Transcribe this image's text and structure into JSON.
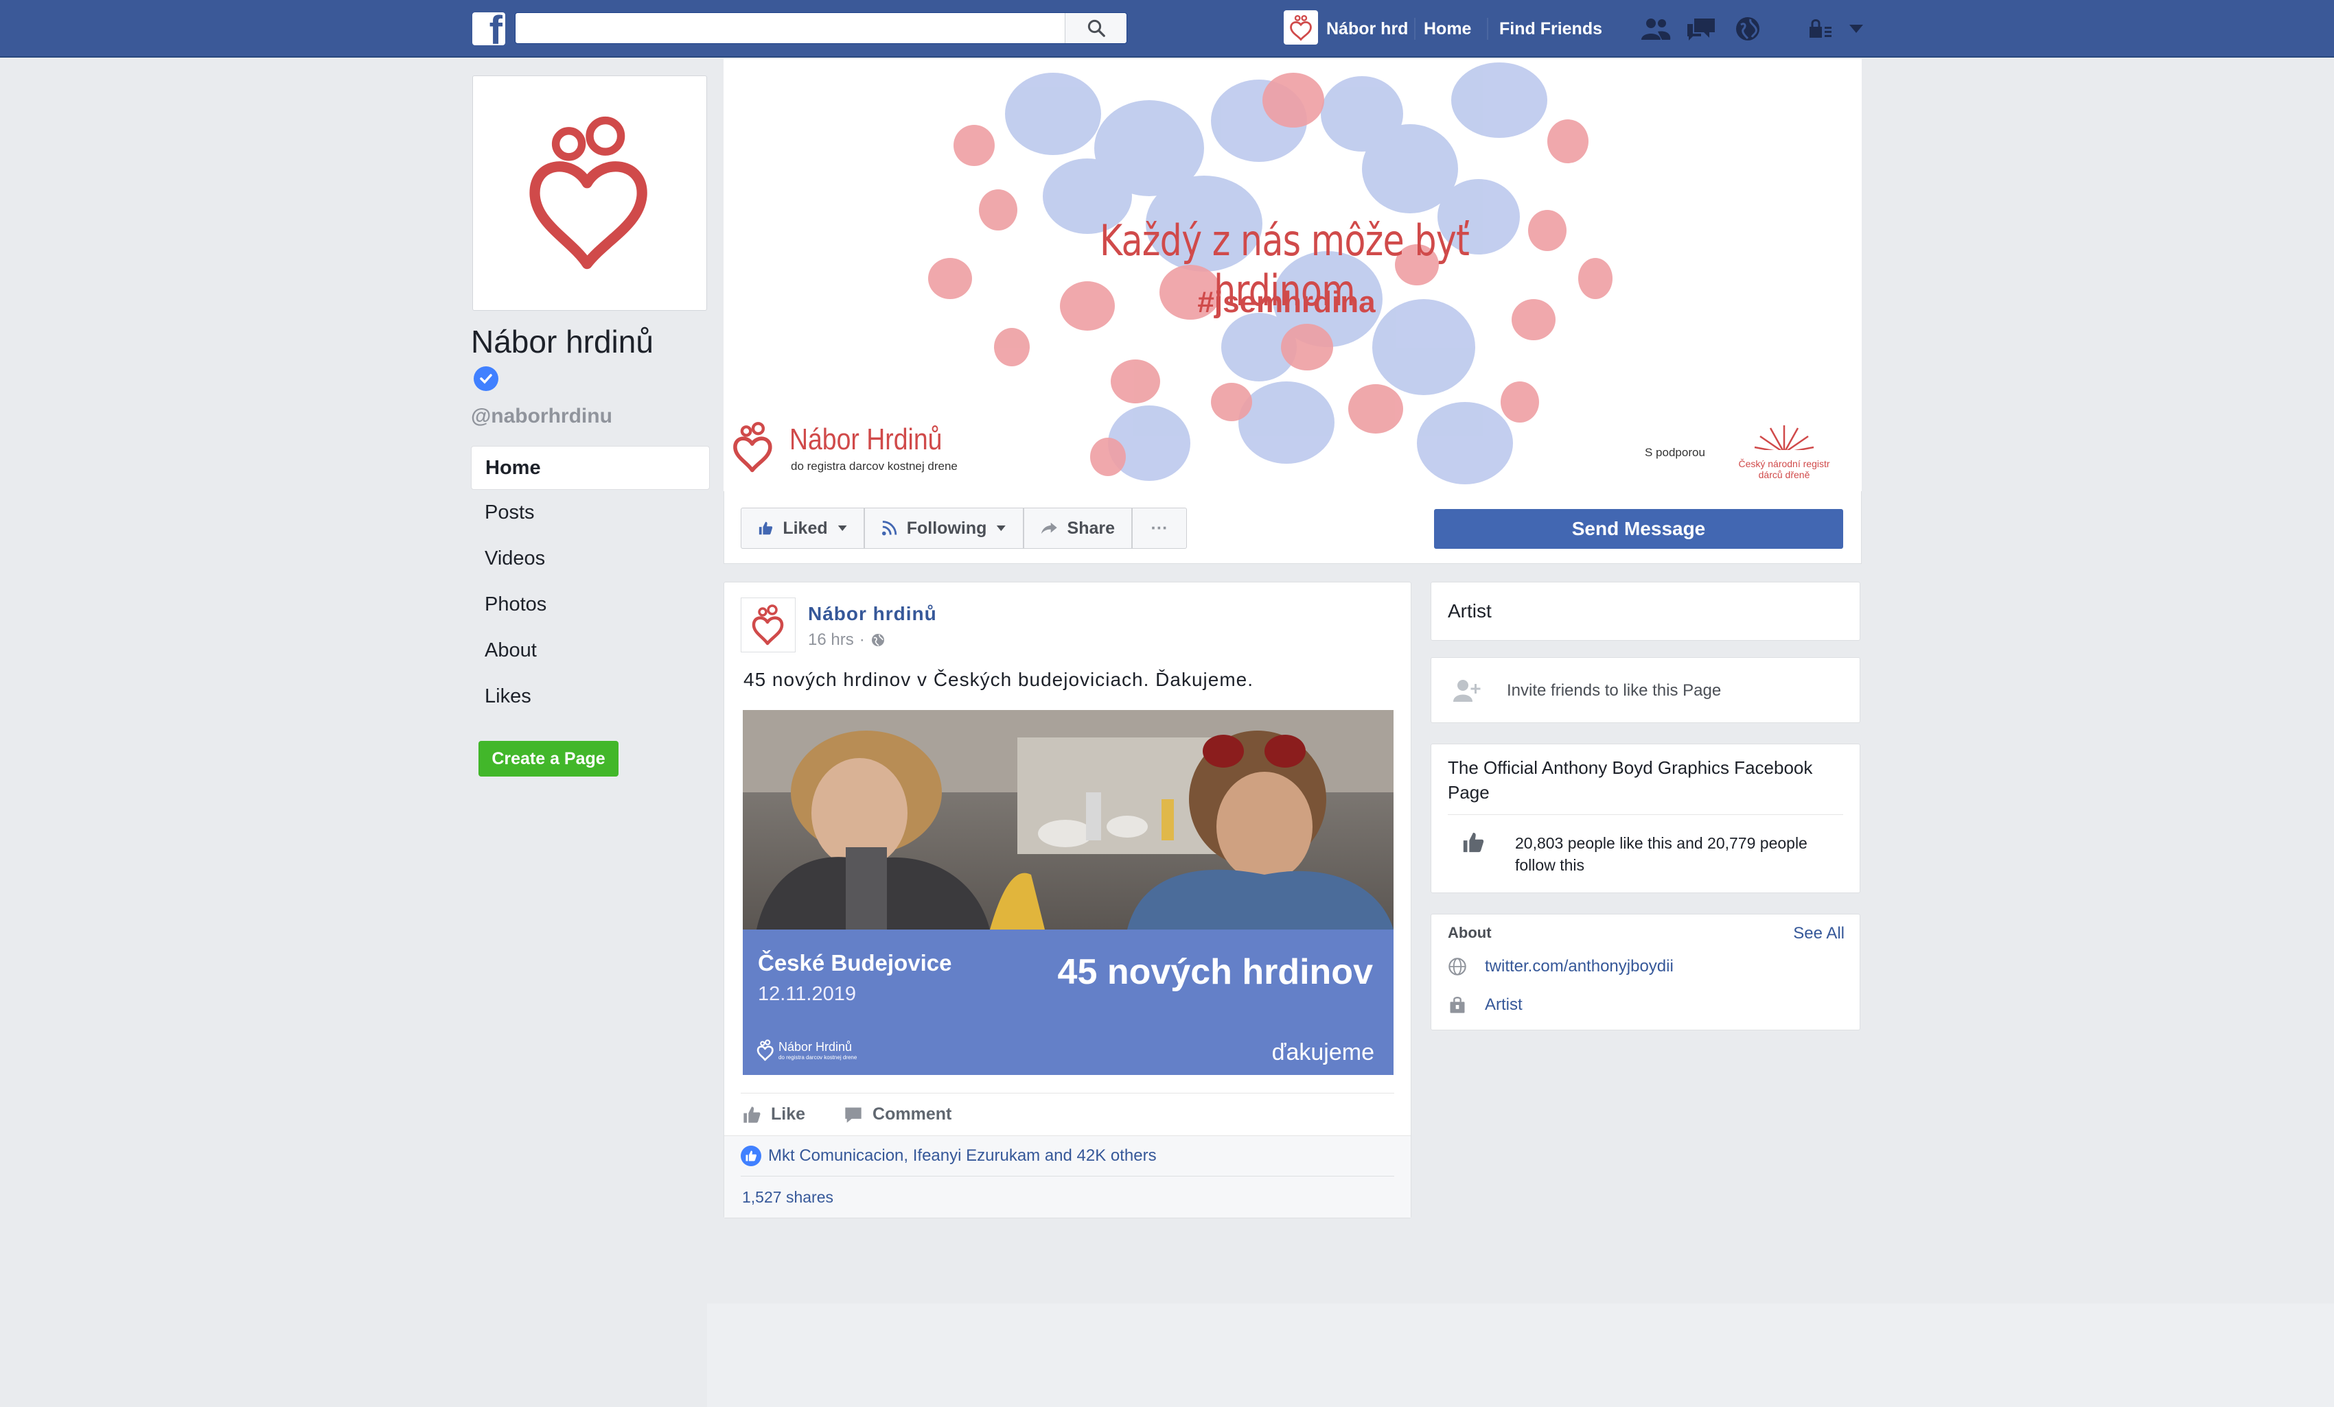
{
  "topbar": {
    "search_placeholder": "",
    "page_shortcut": "Nábor hrd",
    "home": "Home",
    "find_friends": "Find Friends",
    "colors": {
      "bar": "#3b5998",
      "text": "#ffffff"
    }
  },
  "profile": {
    "name": "Nábor hrdinů",
    "handle": "@naborhrdinu",
    "verified": true
  },
  "left_nav": {
    "items": [
      {
        "label": "Home",
        "active": true
      },
      {
        "label": "Posts"
      },
      {
        "label": "Videos"
      },
      {
        "label": "Photos"
      },
      {
        "label": "About"
      },
      {
        "label": "Likes"
      }
    ],
    "create_page": "Create a Page"
  },
  "cover": {
    "headline": "Každý z nás môže byť hrdinom",
    "hashtag": "#jsemhrdina",
    "brand": "Nábor Hrdinů",
    "brand_sub": "do registra darcov kostnej drene",
    "support_label": "S podporou",
    "partner": "Český národní registr dárců dřeně",
    "colors": {
      "red": "#d04a4a",
      "blue": "#a9b9e6",
      "pink": "#ee9fa3"
    }
  },
  "actions": {
    "liked": "Liked",
    "following": "Following",
    "share": "Share",
    "more": "···",
    "send_message": "Send Message"
  },
  "post": {
    "author": "Nábor hrdinů",
    "time": "16 hrs",
    "text": "45 nových hrdinov v Českých budejoviciach. Ďakujeme.",
    "image": {
      "city": "České Budejovice",
      "date": "12.11.2019",
      "headline": "45 nových hrdinov",
      "thanks": "ďakujeme",
      "logo": "Nábor Hrdinů",
      "logo_sub": "do registra darcov kostnej drene"
    },
    "like": "Like",
    "comment": "Comment",
    "reactions_text": "Mkt Comunicacion, Ifeanyi Ezurukam and 42K others",
    "shares": "1,527 shares"
  },
  "sidebar": {
    "category": "Artist",
    "invite": "Invite friends to like this Page",
    "official_title": "The Official Anthony Boyd Graphics Facebook Page",
    "stats": "20,803 people like this and 20,779 people follow this",
    "about_heading": "About",
    "see_all": "See All",
    "website": "twitter.com/anthonyjboydii",
    "category_link": "Artist"
  }
}
